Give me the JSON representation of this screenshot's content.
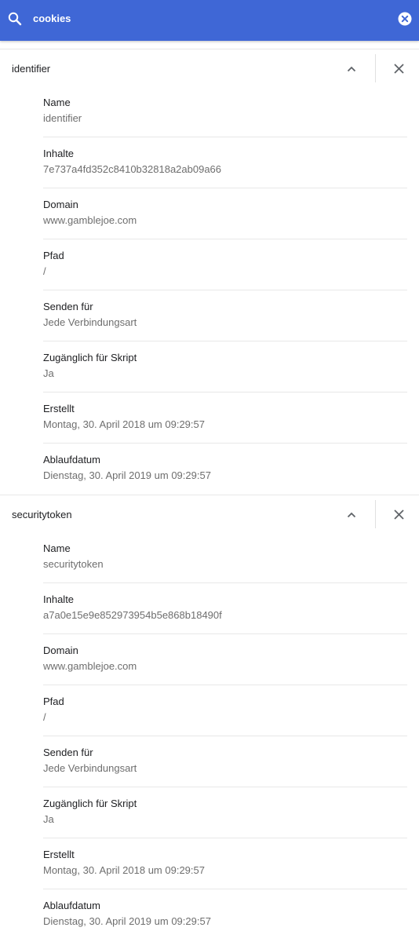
{
  "search": {
    "query": "cookies",
    "icon": "search-icon",
    "clear_icon": "clear-icon"
  },
  "colors": {
    "header_bg": "#3f67d6",
    "label": "#202124",
    "value": "#6e6e6e"
  },
  "cookies": [
    {
      "title": "identifier",
      "fields": [
        {
          "label": "Name",
          "value": "identifier"
        },
        {
          "label": "Inhalte",
          "value": "7e737a4fd352c8410b32818a2ab09a66"
        },
        {
          "label": "Domain",
          "value": "www.gamblejoe.com"
        },
        {
          "label": "Pfad",
          "value": "/"
        },
        {
          "label": "Senden für",
          "value": "Jede Verbindungsart"
        },
        {
          "label": "Zugänglich für Skript",
          "value": "Ja"
        },
        {
          "label": "Erstellt",
          "value": "Montag, 30. April 2018 um 09:29:57"
        },
        {
          "label": "Ablaufdatum",
          "value": "Dienstag, 30. April 2019 um 09:29:57"
        }
      ]
    },
    {
      "title": "securitytoken",
      "fields": [
        {
          "label": "Name",
          "value": "securitytoken"
        },
        {
          "label": "Inhalte",
          "value": "a7a0e15e9e852973954b5e868b18490f"
        },
        {
          "label": "Domain",
          "value": "www.gamblejoe.com"
        },
        {
          "label": "Pfad",
          "value": "/"
        },
        {
          "label": "Senden für",
          "value": "Jede Verbindungsart"
        },
        {
          "label": "Zugänglich für Skript",
          "value": "Ja"
        },
        {
          "label": "Erstellt",
          "value": "Montag, 30. April 2018 um 09:29:57"
        },
        {
          "label": "Ablaufdatum",
          "value": "Dienstag, 30. April 2019 um 09:29:57"
        }
      ]
    }
  ]
}
